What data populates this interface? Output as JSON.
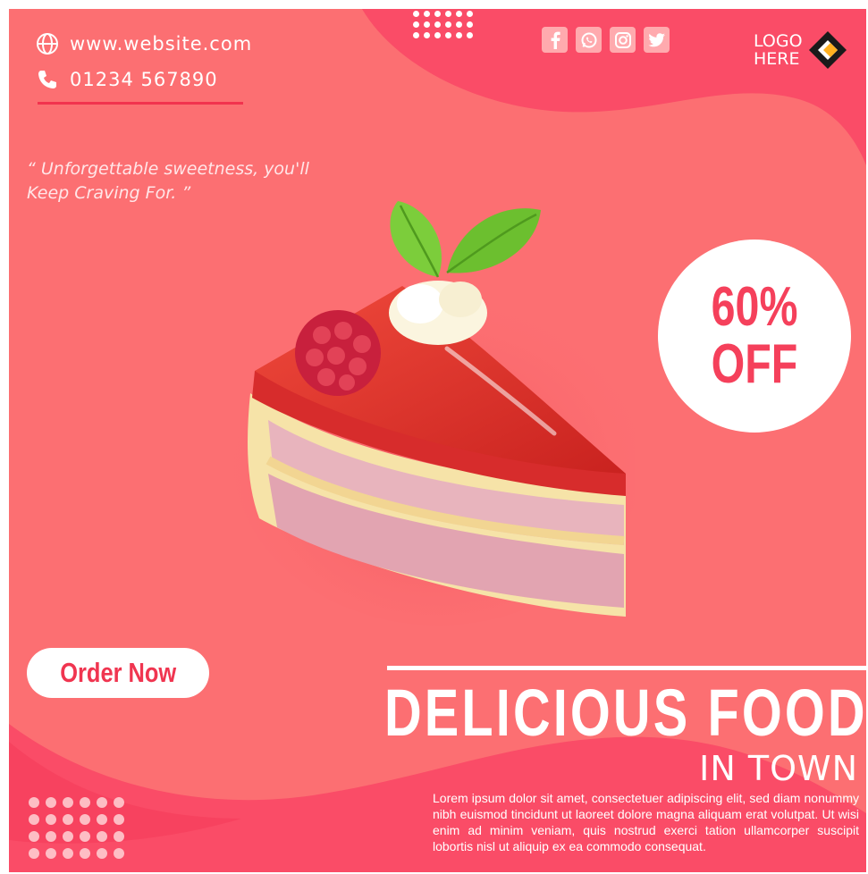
{
  "contact": {
    "website": "www.website.com",
    "phone": "01234 567890",
    "website_icon": "globe-icon",
    "phone_icon": "phone-icon"
  },
  "quote": "“ Unforgettable sweetness, you'll Keep Craving For. ”",
  "social": [
    {
      "icon": "facebook-icon"
    },
    {
      "icon": "whatsapp-icon"
    },
    {
      "icon": "instagram-icon"
    },
    {
      "icon": "twitter-icon"
    }
  ],
  "logo": {
    "line1": "LOGO",
    "line2": "HERE"
  },
  "discount": {
    "line1": "60%",
    "line2": "OFF"
  },
  "order_button": "Order Now",
  "headline": "DELICIOUS FOOD",
  "subheadline": "IN TOWN",
  "body": "Lorem ipsum dolor sit amet, consectetuer adipiscing elit, sed diam nonummy nibh euismod tincidunt ut laoreet dolore magna aliquam erat volutpat. Ut wisi enim ad minim veniam, quis nostrud exerci tation ullamcorper suscipit lobortis nisl ut aliquip ex ea commodo consequat.",
  "colors": {
    "background": "#fc6f72",
    "accent": "#f5405b",
    "wave": "#fa4c67",
    "white": "#ffffff"
  }
}
